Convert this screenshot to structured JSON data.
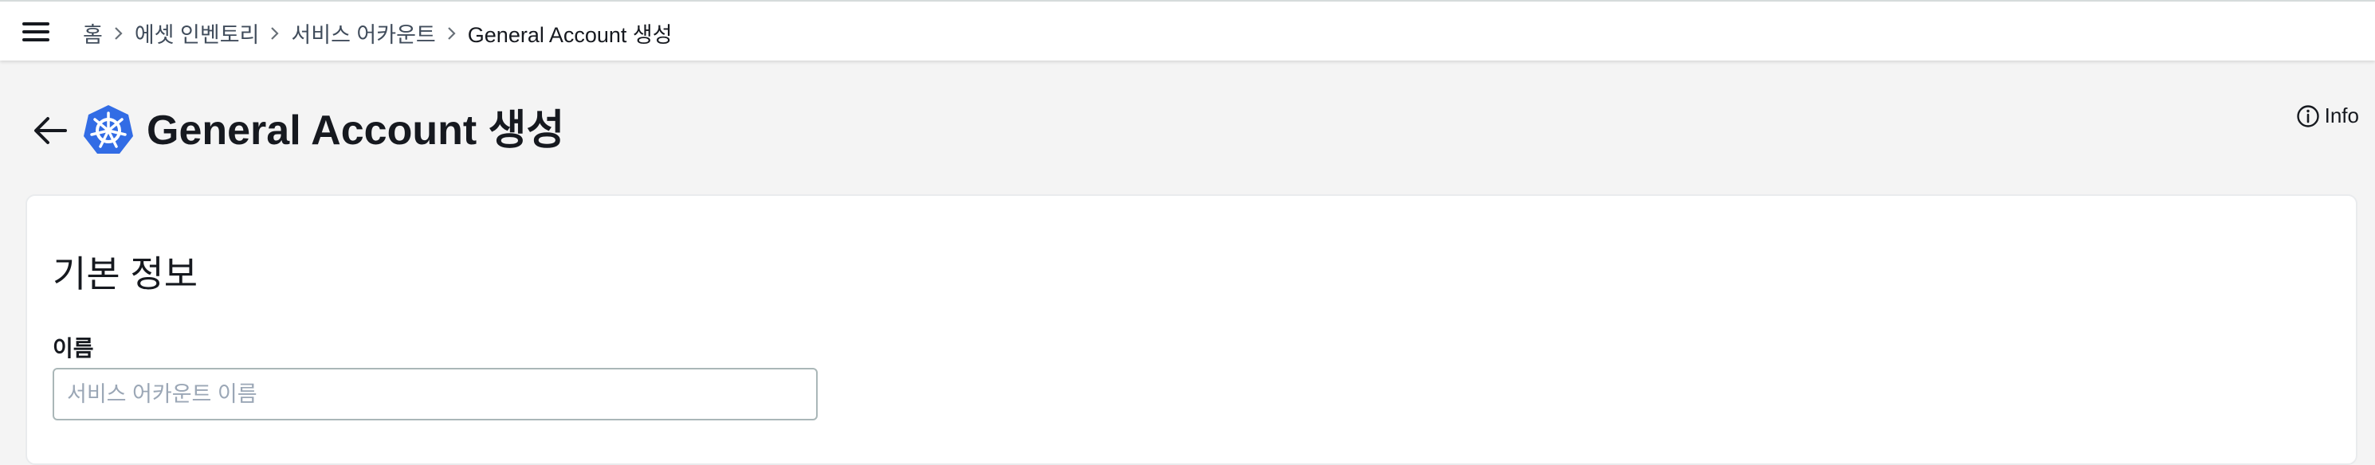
{
  "breadcrumb": {
    "items": [
      "홈",
      "에셋 인벤토리",
      "서비스 어카운트"
    ],
    "current": "General Account 생성"
  },
  "header": {
    "title": "General Account 생성",
    "info_label": "Info"
  },
  "form": {
    "section_title": "기본 정보",
    "name_label": "이름",
    "name_value": "",
    "name_placeholder": "서비스 어카운트 이름"
  },
  "colors": {
    "kubernetes_blue": "#326ce5",
    "background": "#f4f4f4",
    "text": "#16191f"
  },
  "icons": [
    "menu-icon",
    "chevron-right-icon",
    "back-arrow-icon",
    "kubernetes-icon",
    "info-icon"
  ]
}
